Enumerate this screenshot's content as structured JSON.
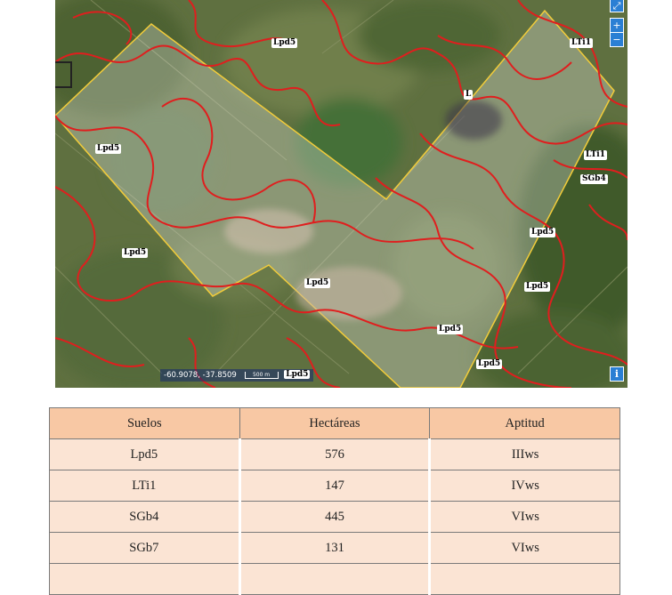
{
  "map": {
    "coordinate_readout": "-60.9078, -37.8509",
    "scale_label": "500 m",
    "controls": {
      "fullscreen_icon": "expand-icon",
      "zoom_in": "+",
      "zoom_out": "−",
      "info": "i"
    },
    "colors": {
      "soil_boundary": "#e01e1e",
      "parcel_outline": "#f2cc3a",
      "parcel_fill": "#ffffff"
    },
    "labels": [
      "Lpd5",
      "LTi1",
      "L",
      "Lpd5",
      "LTi1",
      "SGb4",
      "Lpd5",
      "Lpd5",
      "Lpd5",
      "Lpd5",
      "Lpd5",
      "Lpd5",
      "Lpd5"
    ]
  },
  "table": {
    "headers": [
      "Suelos",
      "Hectáreas",
      "Aptitud"
    ],
    "rows": [
      [
        "Lpd5",
        "576",
        "IIIws"
      ],
      [
        "LTi1",
        "147",
        "IVws"
      ],
      [
        "SGb4",
        "445",
        "VIws"
      ],
      [
        "SGb7",
        "131",
        "VIws"
      ]
    ]
  }
}
